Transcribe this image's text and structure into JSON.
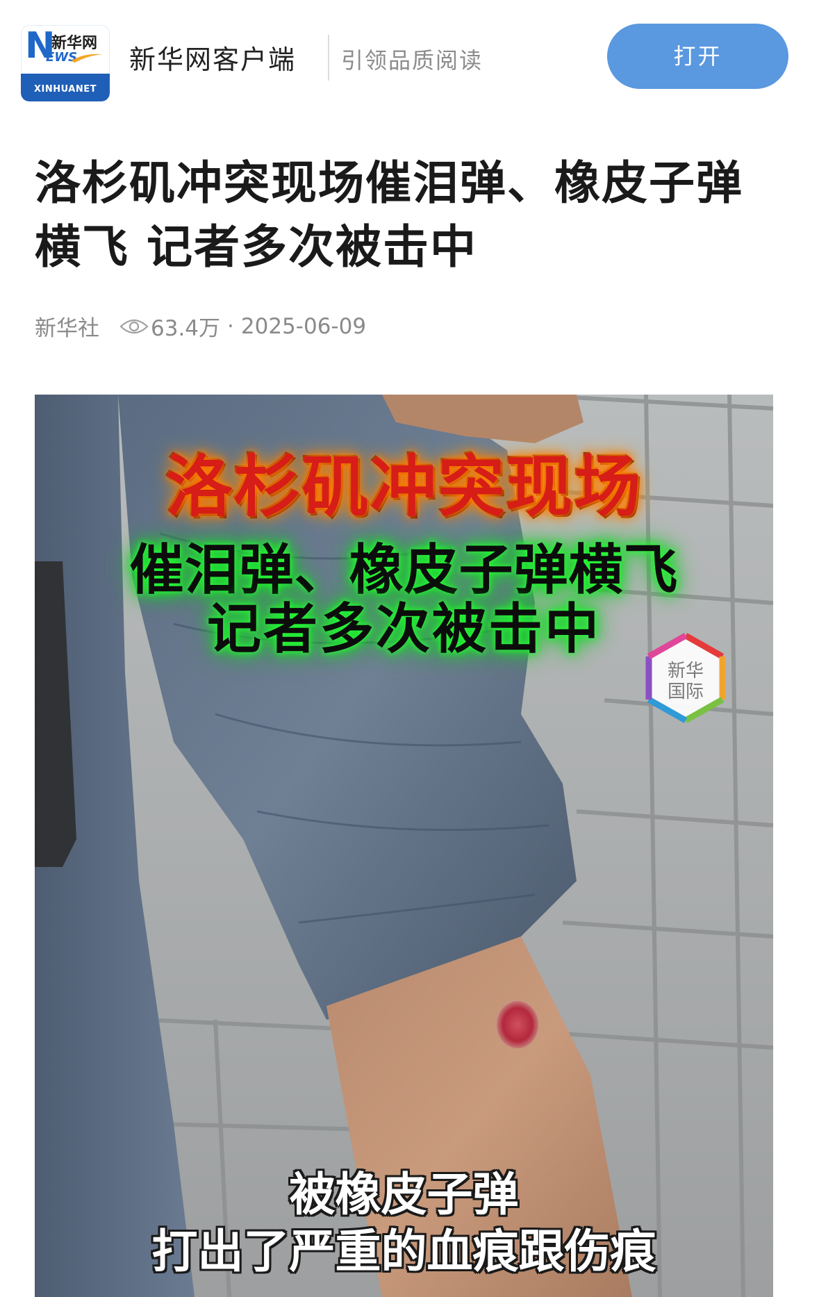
{
  "app_bar": {
    "logo": {
      "letter": "N",
      "ews": "EWS",
      "cn_name": "新华网",
      "en_name": "XINHUANET",
      "brand_color": "#1f5fb8",
      "accent_color": "#f5a623"
    },
    "app_name": "新华网客户端",
    "slogan": "引领品质阅读",
    "open_button_label": "打开",
    "button_color": "#5a98e0"
  },
  "article": {
    "title": "洛杉矶冲突现场催泪弹、橡皮子弹横飞 记者多次被击中",
    "source": "新华社",
    "view_icon": "eye-icon",
    "views": "63.4万",
    "separator": "·",
    "date": "2025-06-09"
  },
  "photo": {
    "overlay_title": "洛杉矶冲突现场",
    "overlay_sub_line1": "催泪弹、橡皮子弹横飞",
    "overlay_sub_line2": "记者多次被击中",
    "watermark_line1": "新华",
    "watermark_line2": "国际",
    "caption_line1": "被橡皮子弹",
    "caption_line2": "打出了严重的血痕跟伤痕"
  }
}
